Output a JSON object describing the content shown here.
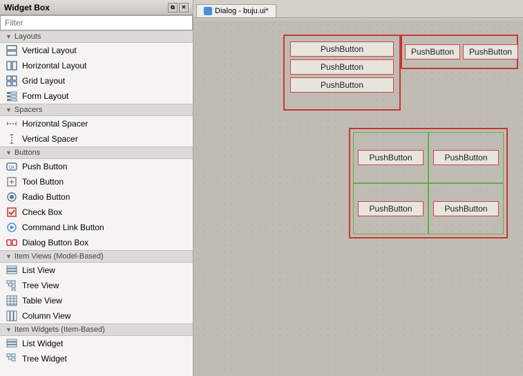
{
  "titlebar": {
    "title": "Widget Box",
    "controls": [
      "_",
      "□",
      "✕"
    ]
  },
  "dialog_tab": {
    "icon": "qt-icon",
    "label": "Dialog - buju.ui*"
  },
  "filter": {
    "placeholder": "Filter"
  },
  "sidebar": {
    "categories": [
      {
        "id": "layouts",
        "label": "Layouts",
        "items": [
          {
            "id": "vertical-layout",
            "label": "Vertical Layout",
            "icon": "vbox"
          },
          {
            "id": "horizontal-layout",
            "label": "Horizontal Layout",
            "icon": "hbox"
          },
          {
            "id": "grid-layout",
            "label": "Grid Layout",
            "icon": "grid"
          },
          {
            "id": "form-layout",
            "label": "Form Layout",
            "icon": "form"
          }
        ]
      },
      {
        "id": "spacers",
        "label": "Spacers",
        "items": [
          {
            "id": "horizontal-spacer",
            "label": "Horizontal Spacer",
            "icon": "hspacer"
          },
          {
            "id": "vertical-spacer",
            "label": "Vertical Spacer",
            "icon": "vspacer"
          }
        ]
      },
      {
        "id": "buttons",
        "label": "Buttons",
        "items": [
          {
            "id": "push-button",
            "label": "Push Button",
            "icon": "pushbtn"
          },
          {
            "id": "tool-button",
            "label": "Tool Button",
            "icon": "toolbtn"
          },
          {
            "id": "radio-button",
            "label": "Radio Button",
            "icon": "radiobtn"
          },
          {
            "id": "check-box",
            "label": "Check Box",
            "icon": "checkbox"
          },
          {
            "id": "command-link-button",
            "label": "Command Link Button",
            "icon": "cmdlink"
          },
          {
            "id": "dialog-button-box",
            "label": "Dialog Button Box",
            "icon": "dialogbtnbox"
          }
        ]
      },
      {
        "id": "item-views",
        "label": "Item Views (Model-Based)",
        "items": [
          {
            "id": "list-view",
            "label": "List View",
            "icon": "listview"
          },
          {
            "id": "tree-view",
            "label": "Tree View",
            "icon": "treeview"
          },
          {
            "id": "table-view",
            "label": "Table View",
            "icon": "tableview"
          },
          {
            "id": "column-view",
            "label": "Column View",
            "icon": "columnview"
          }
        ]
      },
      {
        "id": "item-widgets",
        "label": "Item Widgets (Item-Based)",
        "items": [
          {
            "id": "list-widget",
            "label": "List Widget",
            "icon": "listwidget"
          },
          {
            "id": "tree-widget",
            "label": "Tree Widget",
            "icon": "treewidget"
          }
        ]
      }
    ]
  },
  "dialog": {
    "form_layout": {
      "buttons": [
        "PushButton",
        "PushButton",
        "PushButton"
      ]
    },
    "h_layout": {
      "buttons": [
        "PushButton",
        "PushButton"
      ]
    },
    "grid_layout": {
      "buttons": [
        "PushButton",
        "PushButton",
        "PushButton",
        "PushButton"
      ]
    }
  },
  "colors": {
    "accent": "#cc3333",
    "grid_line": "#66aa44",
    "qt_blue": "#4a90d9"
  }
}
